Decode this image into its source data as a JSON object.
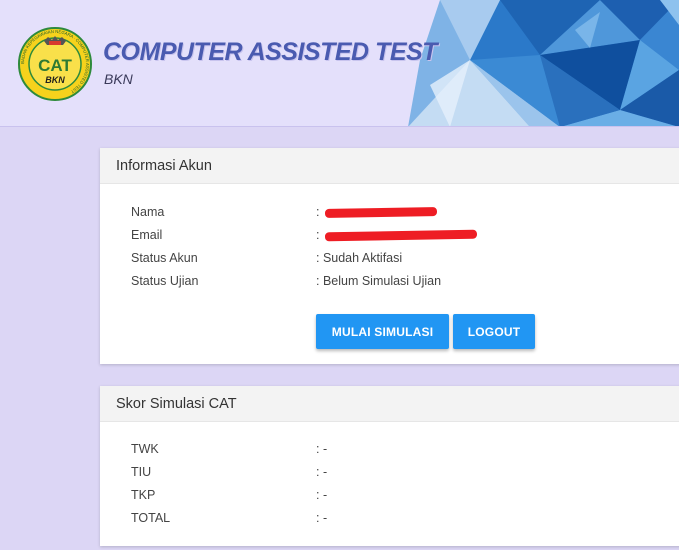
{
  "header": {
    "logo": {
      "text": "CAT",
      "subtext": "BKN",
      "ring_text": "BADAN KEPEGAWAIAN NEGARA · COMPUTER ASSISTED TEST"
    },
    "title": "COMPUTER ASSISTED TEST",
    "subtitle": "BKN"
  },
  "account": {
    "heading": "Informasi Akun",
    "rows": [
      {
        "label": "Nama",
        "value": ":",
        "redacted": true
      },
      {
        "label": "Email",
        "value": ":",
        "redacted": true
      },
      {
        "label": "Status Akun",
        "value": ": Sudah Aktifasi"
      },
      {
        "label": "Status Ujian",
        "value": ": Belum Simulasi Ujian"
      }
    ],
    "buttons": {
      "start_simulation": "MULAI SIMULASI",
      "logout": "LOGOUT"
    }
  },
  "score": {
    "heading": "Skor Simulasi CAT",
    "rows": [
      {
        "label": "TWK",
        "value": ": -"
      },
      {
        "label": "TIU",
        "value": ": -"
      },
      {
        "label": "TKP",
        "value": ": -"
      },
      {
        "label": "TOTAL",
        "value": ": -"
      }
    ]
  },
  "colors": {
    "page_background": "#dcd6f5",
    "title": "#4a5bb0",
    "button": "#2196f3",
    "redaction": "#ee1d24",
    "logo_yellow": "#f6d21c",
    "logo_green": "#2e8a3c"
  }
}
